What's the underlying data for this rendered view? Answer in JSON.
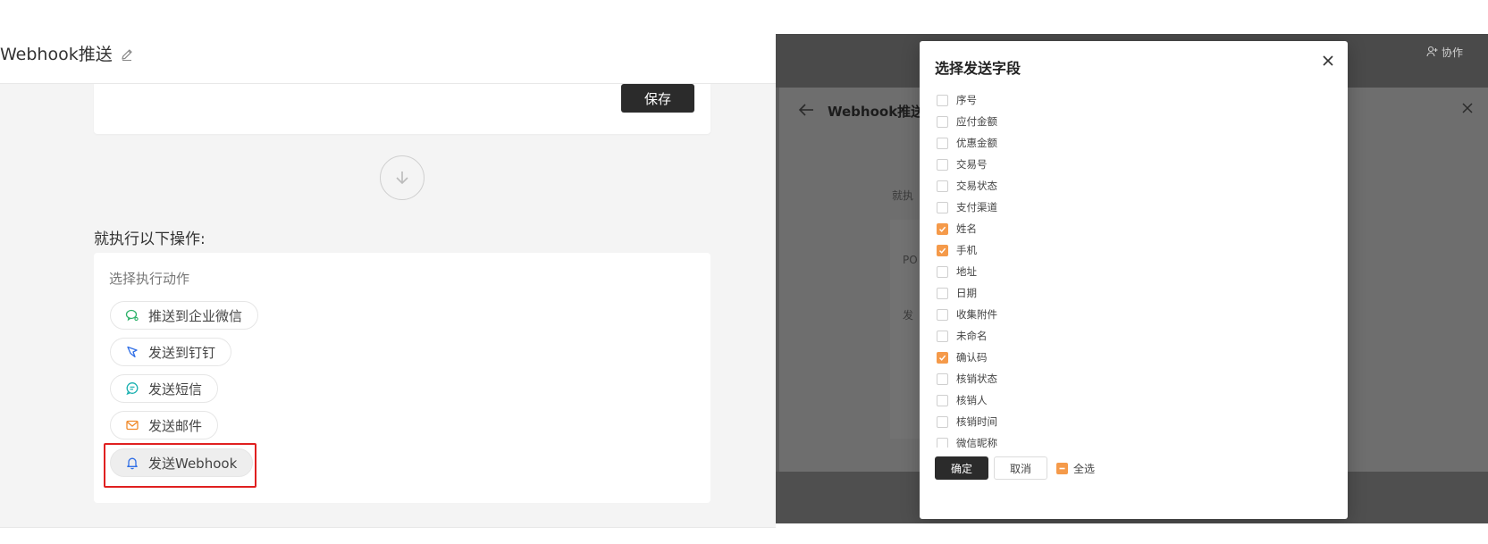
{
  "left": {
    "title": "Webhook推送",
    "save_label": "保存",
    "exec_label": "就执行以下操作:",
    "choose_label": "选择执行动作",
    "actions": [
      {
        "label": "推送到企业微信",
        "icon": "wechat-work-icon",
        "color": "#2fb26a"
      },
      {
        "label": "发送到钉钉",
        "icon": "dingtalk-icon",
        "color": "#2f6ee6"
      },
      {
        "label": "发送短信",
        "icon": "sms-icon",
        "color": "#1ab0b0"
      },
      {
        "label": "发送邮件",
        "icon": "mail-icon",
        "color": "#f08a2a"
      },
      {
        "label": "发送Webhook",
        "icon": "bell-icon",
        "color": "#2f6ee6"
      }
    ],
    "highlight_color": "#e02020"
  },
  "right": {
    "collab_label": "协作",
    "bg_dialog_title": "Webhook推送",
    "bg_faint_texts": [
      "就执",
      "PO",
      "发"
    ],
    "modal": {
      "title": "选择发送字段",
      "fields": [
        {
          "label": "序号",
          "checked": false
        },
        {
          "label": "应付金额",
          "checked": false
        },
        {
          "label": "优惠金额",
          "checked": false
        },
        {
          "label": "交易号",
          "checked": false
        },
        {
          "label": "交易状态",
          "checked": false
        },
        {
          "label": "支付渠道",
          "checked": false
        },
        {
          "label": "姓名",
          "checked": true
        },
        {
          "label": "手机",
          "checked": true
        },
        {
          "label": "地址",
          "checked": false
        },
        {
          "label": "日期",
          "checked": false
        },
        {
          "label": "收集附件",
          "checked": false
        },
        {
          "label": "未命名",
          "checked": false
        },
        {
          "label": "确认码",
          "checked": true
        },
        {
          "label": "核销状态",
          "checked": false
        },
        {
          "label": "核销人",
          "checked": false
        },
        {
          "label": "核销时间",
          "checked": false
        },
        {
          "label": "微信昵称",
          "checked": false
        }
      ],
      "ok_label": "确定",
      "cancel_label": "取消",
      "select_all_label": "全选",
      "accent_color": "#f59a4a"
    }
  }
}
